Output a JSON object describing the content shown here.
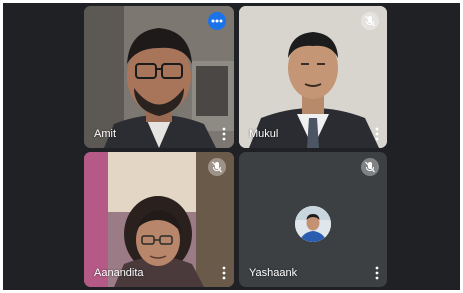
{
  "participants": [
    {
      "name": "Amit",
      "status": "speaking",
      "status_icon": "more-horiz-icon"
    },
    {
      "name": "Mukul",
      "status": "muted",
      "status_icon": "mic-off-icon"
    },
    {
      "name": "Aanandita",
      "status": "muted",
      "status_icon": "mic-off-icon"
    },
    {
      "name": "Yashaank",
      "status": "muted",
      "status_icon": "mic-off-icon",
      "camera": "off"
    }
  ],
  "colors": {
    "background": "#202124",
    "speaking_indicator": "#1a73e8",
    "empty_tile": "#3c4043"
  }
}
